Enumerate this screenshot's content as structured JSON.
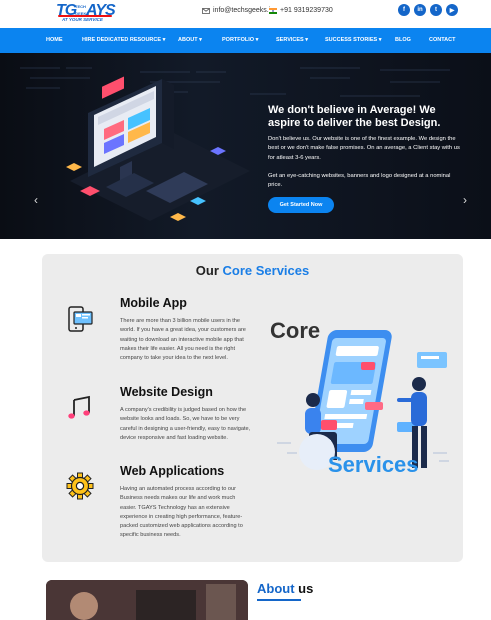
{
  "brand": {
    "logo_tg": "TG",
    "logo_tech": "TECH",
    "logo_geeks": "GEEKS",
    "logo_ays": "AYS",
    "tagline": "AT YOUR SERVICE"
  },
  "topbar": {
    "email": "info@techsgeeks.in",
    "phone": "+91 9319239730",
    "social": [
      {
        "icon": "facebook-icon",
        "glyph": "f"
      },
      {
        "icon": "linkedin-icon",
        "glyph": "in"
      },
      {
        "icon": "twitter-icon",
        "glyph": "t"
      },
      {
        "icon": "youtube-icon",
        "glyph": "▶"
      }
    ]
  },
  "nav": {
    "home": "HOME",
    "hire": "HIRE DEDICATED RESOURCE",
    "about": "ABOUT",
    "portfolio": "PORTFOLIO",
    "services": "SERVICES",
    "success": "SUCCESS STORIES",
    "blog": "BLOG",
    "contact": "CONTACT"
  },
  "hero": {
    "title_line1": "We don't believe in Average! We",
    "title_line2": "aspire to deliver the best Design.",
    "para1": "Don't believe us. Our website is one of the finest example. We design the best or we don't make false promises. On an average, a Client stay with us for atleast 3-6 years.",
    "para2": "Get an eye-catching websites, banners and logo designed at a nominal price.",
    "cta": "Get Started Now",
    "prev": "‹",
    "next": "›"
  },
  "services": {
    "heading_plain": "Our ",
    "heading_accent": "Core Services",
    "illustration_core": "Core",
    "illustration_services": "Services",
    "items": [
      {
        "title": "Mobile App",
        "icon": "mobile-app-icon",
        "description": "There are more than 3 billion mobile users in the world. If you have a great idea, your customers are waiting to download an interactive mobile app that makes their life easier. All you need is the right company to take your idea to the next level."
      },
      {
        "title": "Website Design",
        "icon": "music-note-icon",
        "description": "A company's credibility is judged based on how the website looks and loads. So, we have to be very careful in designing a user-friendly, easy to navigate, device responsive and fast loading website."
      },
      {
        "title": "Web Applications",
        "icon": "gear-icon",
        "description": "Having an automated process according to our Business needs makes our life and work much easier. TGAYS Technology has an extensive experience in creating high performance, feature-packed customized web applications according to specific business needs."
      }
    ]
  },
  "about": {
    "title_accent": "About",
    "title_plain": " us"
  },
  "colors": {
    "primary": "#0b84f0",
    "brand": "#1466c9",
    "accent": "#1a7ee6"
  }
}
